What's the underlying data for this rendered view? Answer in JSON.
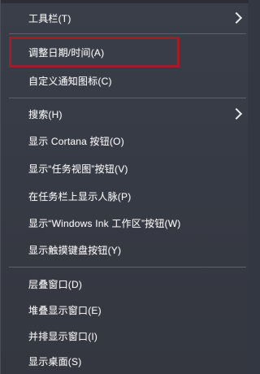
{
  "context_menu": {
    "items": [
      {
        "label": "工具栏(T)",
        "has_submenu": true
      },
      {
        "label": "调整日期/时间(A)",
        "highlighted": true
      },
      {
        "label": "自定义通知图标(C)"
      },
      {
        "label": "搜索(H)",
        "has_submenu": true
      },
      {
        "label": "显示 Cortana 按钮(O)"
      },
      {
        "label": "显示“任务视图”按钮(V)"
      },
      {
        "label": "在任务栏上显示人脉(P)"
      },
      {
        "label": "显示“Windows Ink 工作区”按钮(W)"
      },
      {
        "label": "显示触摸键盘按钮(Y)"
      },
      {
        "label": "层叠窗口(D)"
      },
      {
        "label": "堆叠显示窗口(E)"
      },
      {
        "label": "并排显示窗口(I)"
      },
      {
        "label": "显示桌面(S)"
      }
    ],
    "highlight_color": "#9c1f2b",
    "background_color": "#373b45"
  }
}
